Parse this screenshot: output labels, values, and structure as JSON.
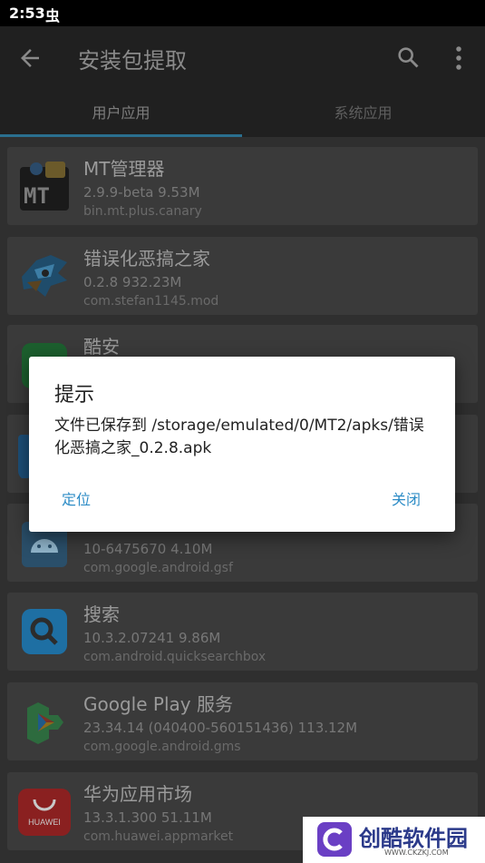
{
  "status_bar": {
    "time": "2:53",
    "notification_glyph": "虫"
  },
  "app_bar": {
    "title": "安装包提取"
  },
  "tabs": [
    {
      "label": "用户应用",
      "active": true
    },
    {
      "label": "系统应用",
      "active": false
    }
  ],
  "apps": [
    {
      "name": "MT管理器",
      "meta": "2.9.9-beta   9.53M",
      "package": "bin.mt.plus.canary",
      "icon": "mt-manager-icon"
    },
    {
      "name": "错误化恶搞之家",
      "meta": "0.2.8   932.23M",
      "package": "com.stefan1145.mod",
      "icon": "bird-character-icon"
    },
    {
      "name": "酷安",
      "meta": "",
      "package": "",
      "icon": "coolapk-icon"
    },
    {
      "name": "",
      "meta": "",
      "package": "",
      "icon": "blue-app-icon"
    },
    {
      "name": "",
      "meta": "10-6475670   4.10M",
      "package": "com.google.android.gsf",
      "icon": "android-services-icon"
    },
    {
      "name": "搜索",
      "meta": "10.3.2.07241   9.86M",
      "package": "com.android.quicksearchbox",
      "icon": "search-app-icon"
    },
    {
      "name": "Google Play 服务",
      "meta": "23.34.14 (040400-560151436)   113.12M",
      "package": "com.google.android.gms",
      "icon": "play-services-icon"
    },
    {
      "name": "华为应用市场",
      "meta": "13.3.1.300   51.11M",
      "package": "com.huawei.appmarket",
      "icon": "huawei-appgallery-icon"
    }
  ],
  "dialog": {
    "title": "提示",
    "message": "文件已保存到 /storage/emulated/0/MT2/apks/错误化恶搞之家_0.2.8.apk",
    "buttons": {
      "locate": "定位",
      "close": "关闭"
    }
  },
  "watermark": {
    "text": "创酷软件园",
    "url": "WWW.CKZKJ.COM",
    "icon_label": "HUAWEI"
  },
  "colors": {
    "accent": "#2d8cc6",
    "tab_indicator": "#2a6f8f",
    "appbar": "#202020"
  }
}
